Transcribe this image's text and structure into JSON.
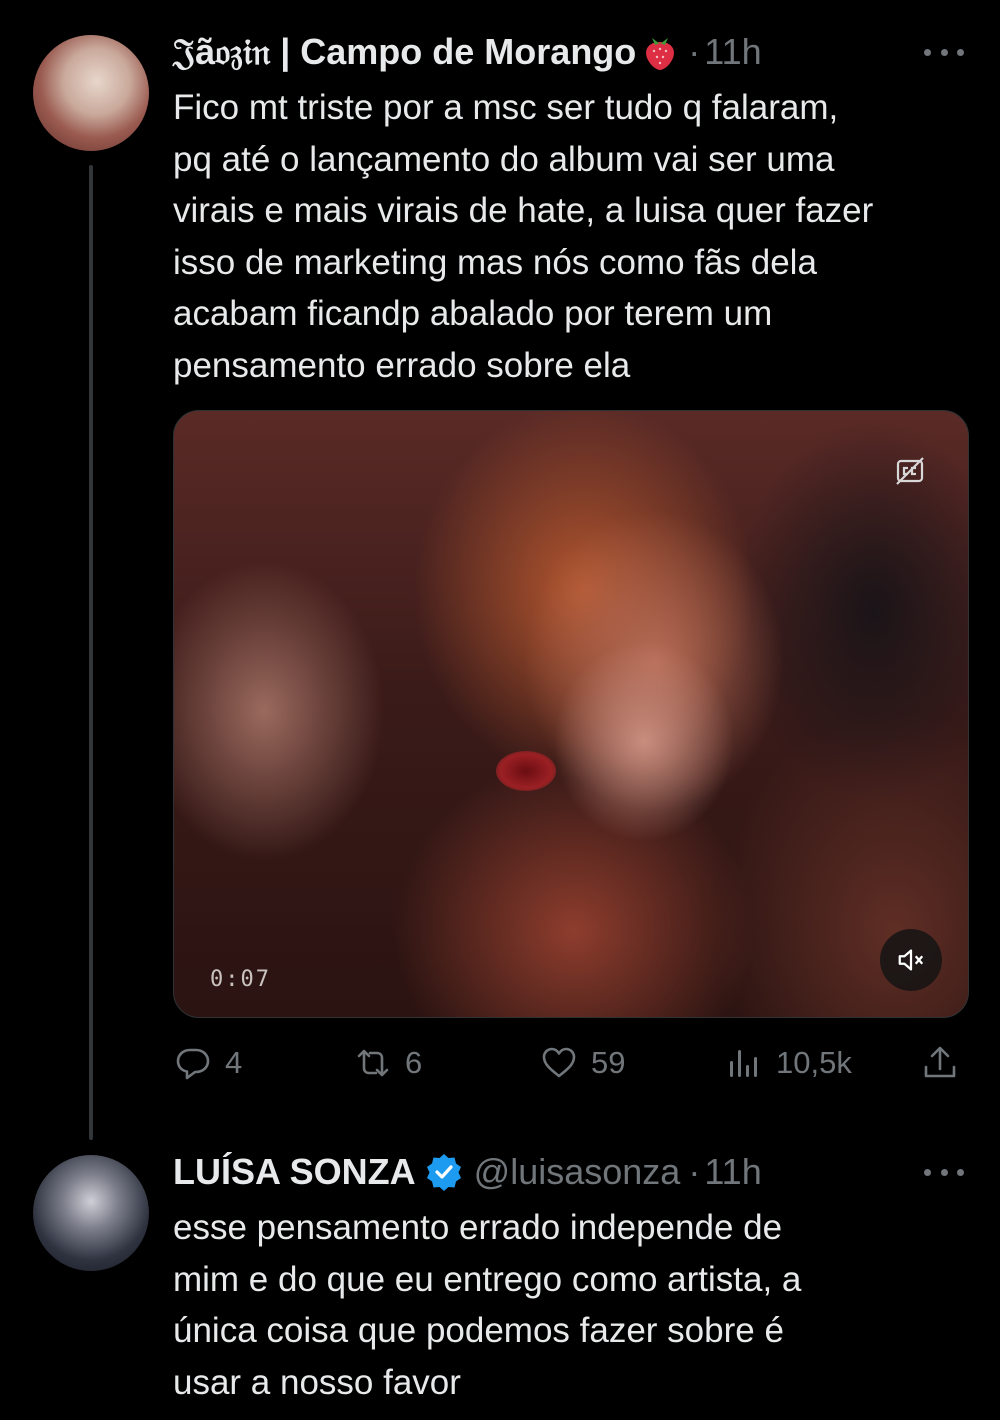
{
  "thread": [
    {
      "display_name": "𝔍ã𝔬𝔷𝔦𝔫 | Campo de Morango",
      "time": "11h",
      "text": "Fico mt triste por a msc ser tudo q falaram,\npq até o lançamento do album vai ser uma\nvirais e mais virais de hate, a luisa quer fazer\nisso de marketing mas nós como fãs dela\nacabam ficandp abalado por terem um\npensamento errado sobre ela",
      "media": {
        "timecode": "0:07"
      },
      "stats": {
        "replies": "4",
        "retweets": "6",
        "likes": "59",
        "views": "10,5k"
      }
    },
    {
      "display_name": "LUÍSA SONZA",
      "handle": "@luisasonza",
      "time": "11h",
      "text": "esse pensamento errado independe de\nmim e do que eu entrego como artista, a\núnica coisa que podemos fazer sobre é\nusar a nosso favor"
    }
  ],
  "colors": {
    "background": "#000000",
    "text": "#e7e9ea",
    "muted": "#71767b",
    "verified": "#1d9bf0"
  }
}
